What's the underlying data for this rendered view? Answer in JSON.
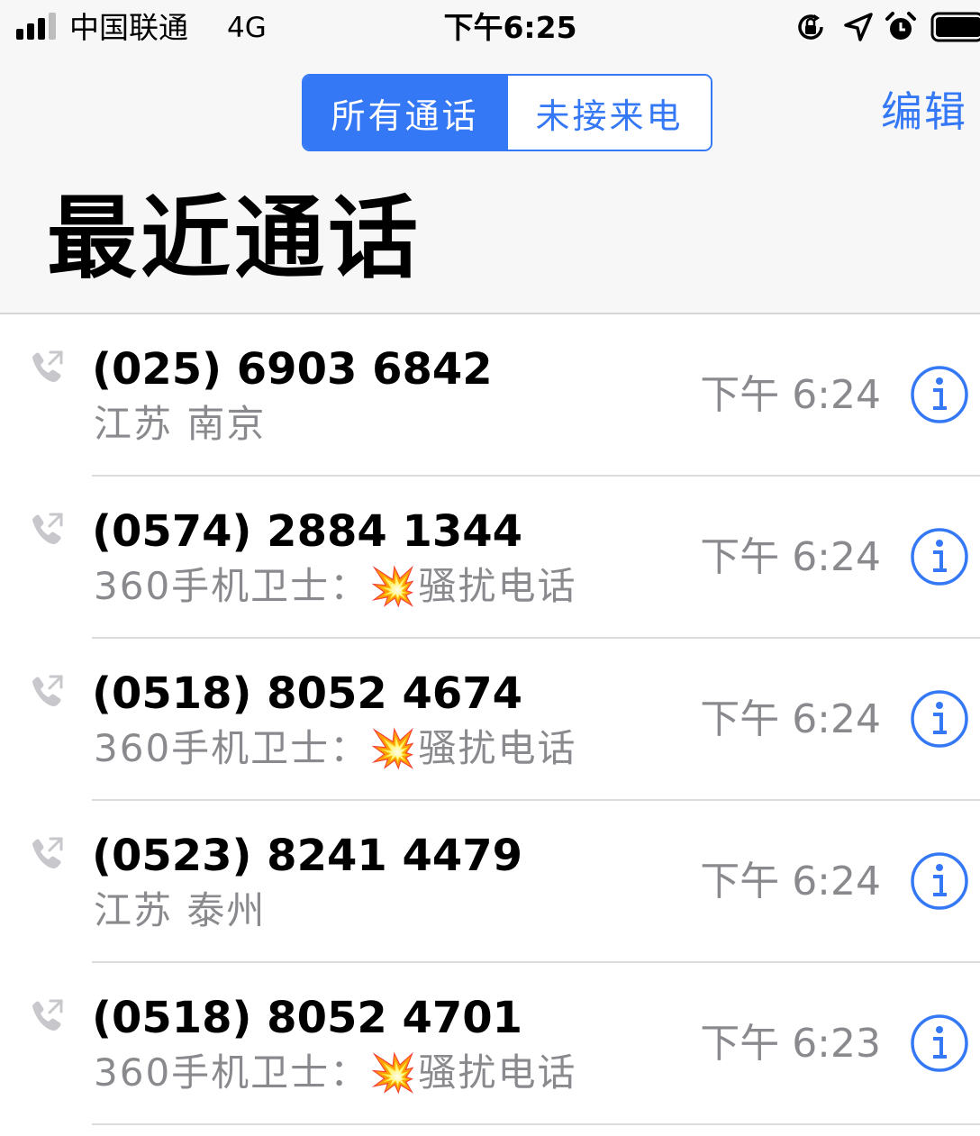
{
  "status_bar": {
    "carrier": "中国联通",
    "network": "4G",
    "time": "下午6:25",
    "icons": [
      "signal-icon",
      "orientation-lock-icon",
      "location-arrow-icon",
      "alarm-icon",
      "battery-icon"
    ]
  },
  "nav": {
    "segments": [
      {
        "label": "所有通话",
        "selected": true
      },
      {
        "label": "未接来电",
        "selected": false
      }
    ],
    "edit_label": "编辑",
    "accent_color": "#3478f6"
  },
  "title": "最近通话",
  "calls": [
    {
      "number": "(025) 6903 6842",
      "subtitle": "江苏 南京",
      "time": "下午 6:24",
      "direction_icon": "outgoing-call-icon",
      "info_icon": "info-icon"
    },
    {
      "number": "(0574) 2884 1344",
      "subtitle": "360手机卫士：💥骚扰电话",
      "time": "下午 6:24",
      "direction_icon": "outgoing-call-icon",
      "info_icon": "info-icon"
    },
    {
      "number": "(0518) 8052 4674",
      "subtitle": "360手机卫士：💥骚扰电话",
      "time": "下午 6:24",
      "direction_icon": "outgoing-call-icon",
      "info_icon": "info-icon"
    },
    {
      "number": "(0523) 8241 4479",
      "subtitle": "江苏 泰州",
      "time": "下午 6:24",
      "direction_icon": "outgoing-call-icon",
      "info_icon": "info-icon"
    },
    {
      "number": "(0518) 8052 4701",
      "subtitle": "360手机卫士：💥骚扰电话",
      "time": "下午 6:23",
      "direction_icon": "outgoing-call-icon",
      "info_icon": "info-icon"
    }
  ]
}
